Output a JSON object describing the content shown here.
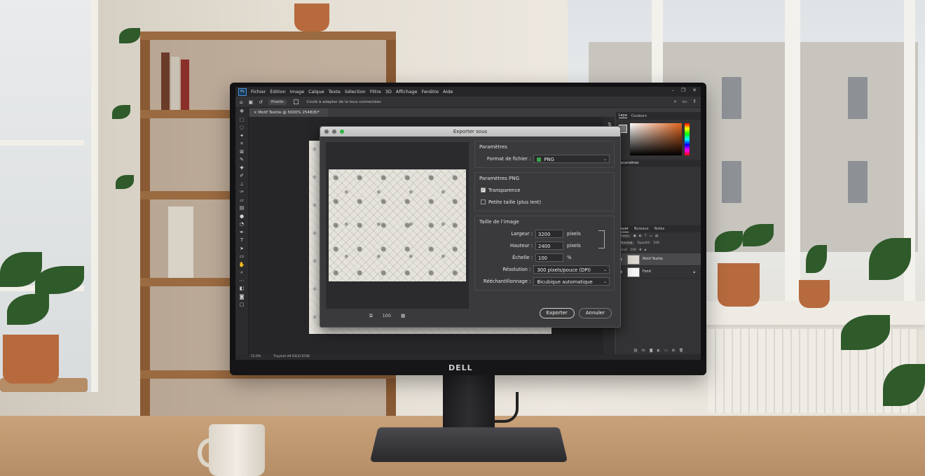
{
  "app": {
    "menu": [
      "Fichier",
      "Édition",
      "Image",
      "Calque",
      "Texte",
      "Sélection",
      "Filtre",
      "3D",
      "Affichage",
      "Fenêtre",
      "Aide"
    ],
    "options_bar": {
      "select_value": "Pixelle",
      "option_text": "Coulé à adapter de la tous connectées"
    },
    "document_tab": "Motif Textile @ 5000% 2548(8)*",
    "status": {
      "zoom": "15.0%",
      "info": "Traymel oft 63(3) 6744"
    }
  },
  "panels": {
    "color_tabs": [
      "Leya",
      "Couleurs"
    ],
    "params_tab": "Paramètres",
    "layers_tabs": [
      "Layer",
      "Bureaux",
      "Notes"
    ],
    "layers_filter": "Lacu",
    "blend_mode": "Normal",
    "opacity_label": "Opacité:",
    "opacity_value": "100",
    "fill_label": "Fond:",
    "fill_value": "100",
    "layers": [
      {
        "name": "Motif Textile",
        "selected": true
      },
      {
        "name": "Fond",
        "selected": false
      }
    ]
  },
  "dialog": {
    "title": "Exporter sous",
    "traffic_colors": [
      "#6e6e70",
      "#6e6e70",
      "#2fb344"
    ],
    "parametres": {
      "title": "Paramètres",
      "format_label": "Format de fichier :",
      "format_value": "PNG"
    },
    "png": {
      "title": "Paramètres PNG",
      "transparency_label": "Transparence",
      "transparency_checked": true,
      "small_label": "Petite taille (plus lent)",
      "small_checked": false
    },
    "taille": {
      "title": "Taille de l’image",
      "width_label": "Largeur :",
      "width_value": "3200",
      "width_unit": "pixels",
      "height_label": "Hauteur :",
      "height_value": "2400",
      "height_unit": "pixels",
      "scale_label": "Échelle :",
      "scale_value": "100",
      "scale_unit": "%",
      "resolution_label": "Résolution :",
      "resolution_value": "300 pixels/pouce (DPI)",
      "resample_label": "Rééchantillonnage :",
      "resample_value": "Bicubique automatique"
    },
    "preview_zoom": "100",
    "export_button": "Exporter",
    "cancel_button": "Annuler"
  },
  "monitor": {
    "brand": "DELL"
  }
}
